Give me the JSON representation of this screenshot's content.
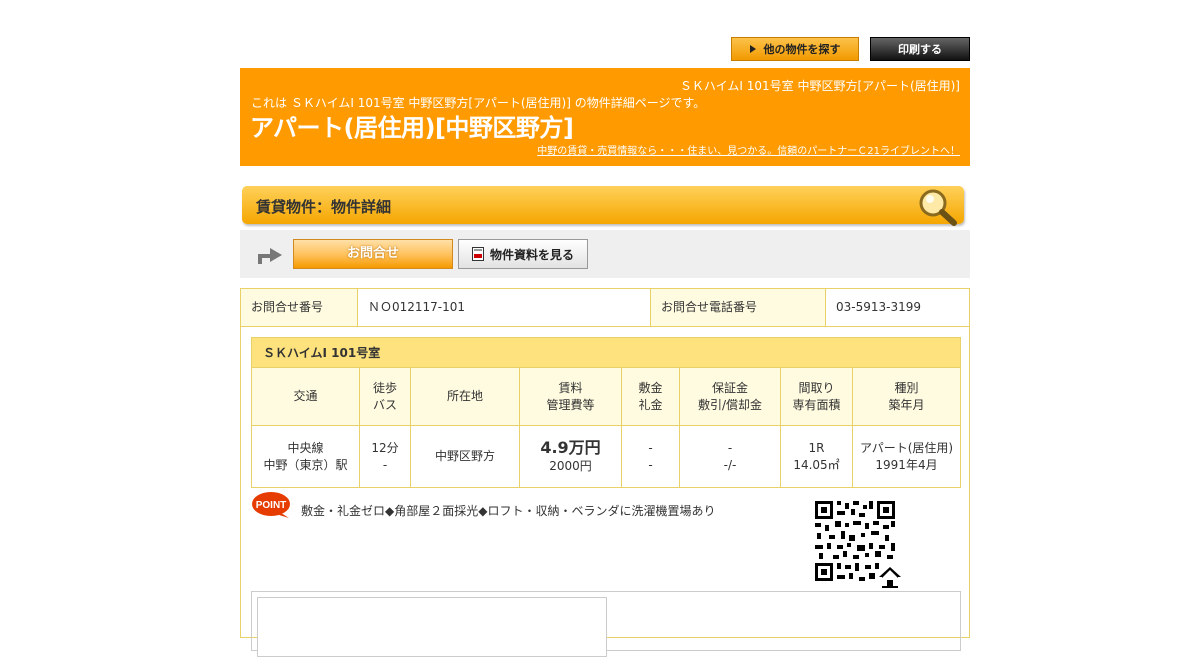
{
  "top_buttons": {
    "search_other": "他の物件を探す",
    "print": "印刷する"
  },
  "header": {
    "right_title": "ＳＫハイムⅠ 101号室 中野区野方[アパート(居住用)]",
    "description": "これは ＳＫハイムⅠ 101号室 中野区野方[アパート(居住用)] の物件詳細ページです。",
    "heading": "アパート(居住用)[中野区野方]",
    "tagline_link": "中野の賃貸・売買情報なら・・・住まい、見つかる。信頼のパートナーＣ21ライブレントへ！"
  },
  "section": {
    "title": "賃貸物件：物件詳細"
  },
  "actions": {
    "contact": "お問合せ",
    "documents": "物件資料を見る"
  },
  "inquiry": {
    "number_label": "お問合せ番号",
    "number_value": "ＮＯ012117-101",
    "phone_label": "お問合せ電話番号",
    "phone_value": "03-5913-3199"
  },
  "property": {
    "name": "ＳＫハイムⅠ 101号室",
    "headers": [
      [
        "交通"
      ],
      [
        "徒歩",
        "バス"
      ],
      [
        "所在地"
      ],
      [
        "賃料",
        "管理費等"
      ],
      [
        "敷金",
        "礼金"
      ],
      [
        "保証金",
        "敷引/償却金"
      ],
      [
        "間取り",
        "専有面積"
      ],
      [
        "種別",
        "築年月"
      ]
    ],
    "row": {
      "transport_line": "中央線",
      "transport_station": "中野（東京）駅",
      "walk": "12分",
      "bus": "-",
      "location": "中野区野方",
      "rent": "4.9万円",
      "management_fee": "2000円",
      "deposit": "-",
      "key_money": "-",
      "guarantee": "-",
      "amortization": "-/-",
      "layout": "1R",
      "area": "14.05㎡",
      "type": "アパート(居住用)",
      "built": "1991年4月"
    }
  },
  "point": {
    "badge": "POINT",
    "text": "敷金・礼金ゼロ◆角部屋２面採光◆ロフト・収納・ベランダに洗濯機置場あり"
  },
  "icons": {
    "magnifier": "magnifier-icon",
    "arrow": "right-arrow-icon",
    "pdf": "pdf-icon",
    "qr": "qr-code",
    "home": "home-icon"
  },
  "colors": {
    "header_orange": "#ff9a00",
    "border_yellow": "#e8d166",
    "cell_cream": "#fffbe1",
    "name_yellow": "#fde27d"
  }
}
